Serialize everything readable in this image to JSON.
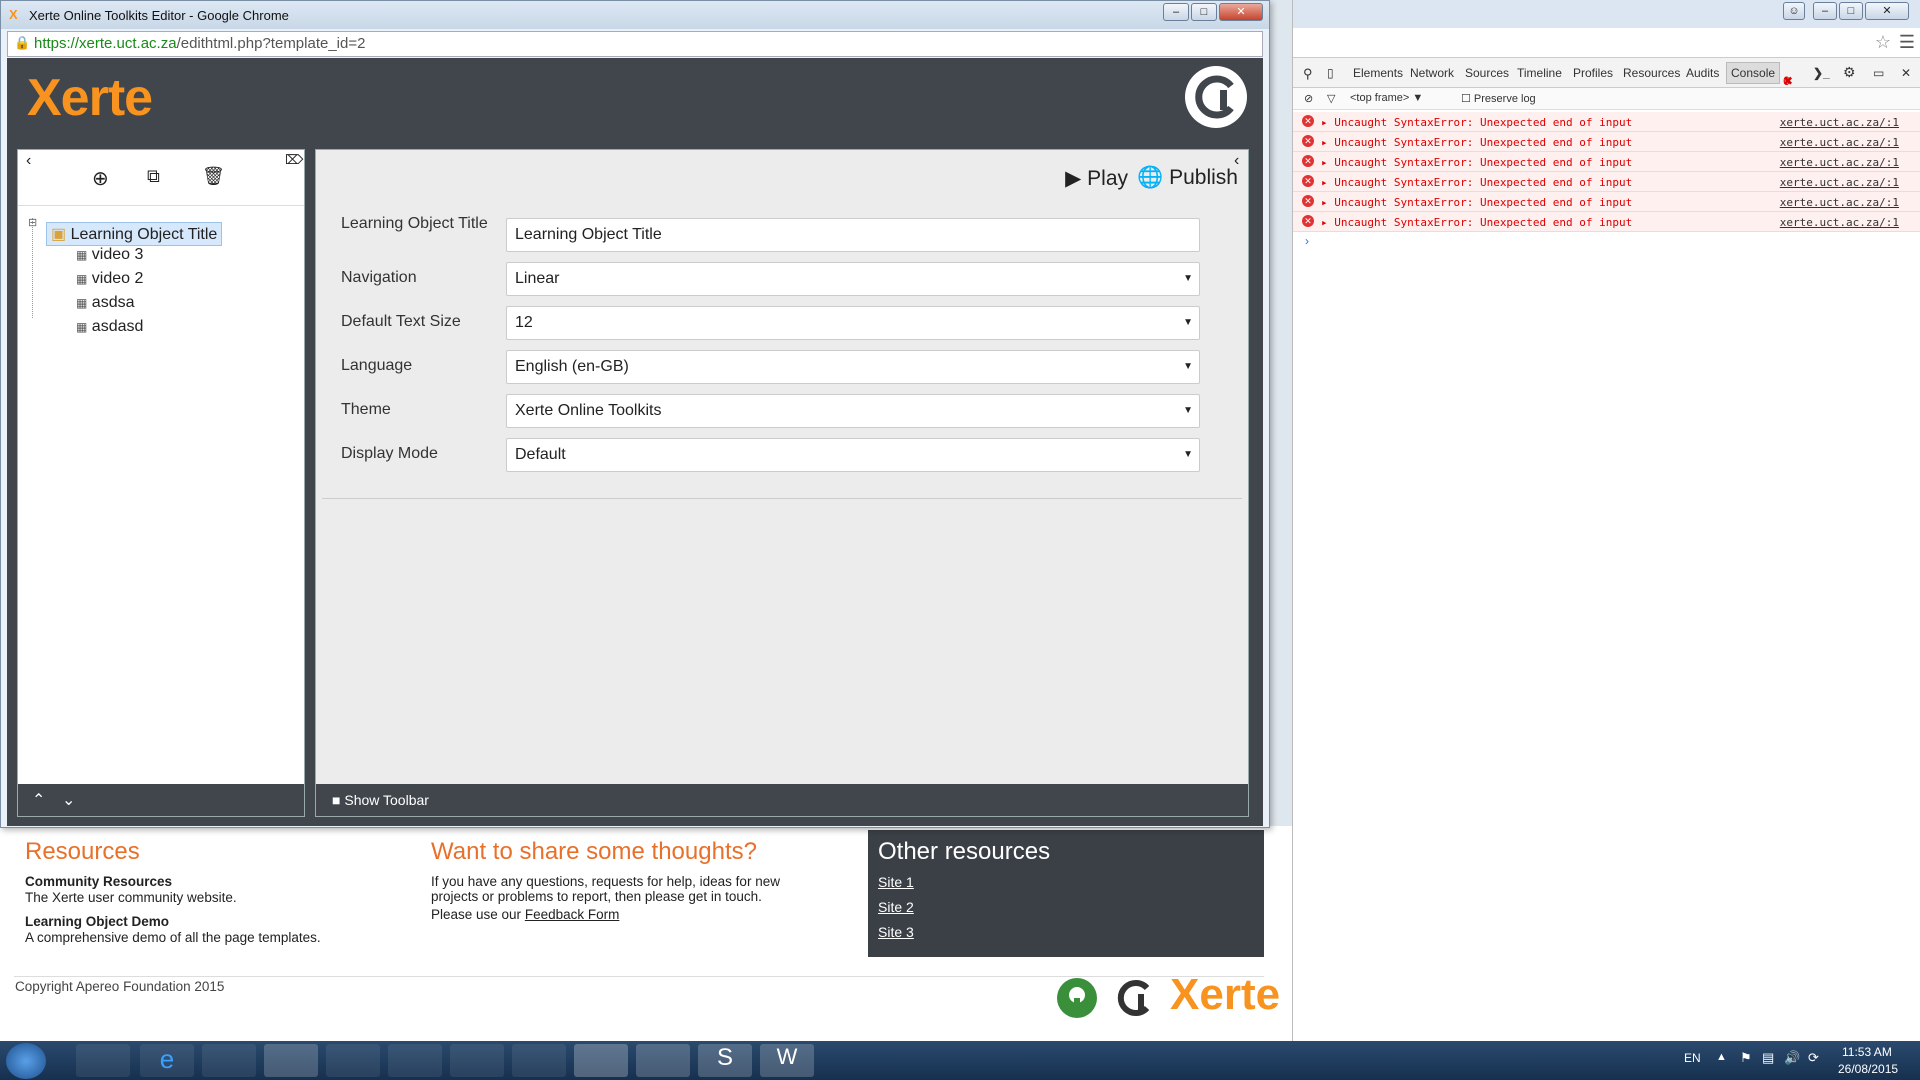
{
  "browser": {
    "window_title": "Xerte Online Toolkits Editor - Google Chrome",
    "url_host": "https://xerte.uct.ac.za",
    "url_path": "/edithtml.php?template_id=2"
  },
  "app": {
    "logo_text": "Xerte",
    "play_label": "Play",
    "publish_label": "Publish",
    "show_toolbar_label": "Show Toolbar"
  },
  "tree": {
    "root": "Learning Object Title",
    "children": [
      "video 3",
      "video 2",
      "asdsa",
      "asdasd"
    ]
  },
  "form": {
    "title_label": "Learning Object Title",
    "title_value": "Learning Object Title",
    "navigation_label": "Navigation",
    "navigation_value": "Linear",
    "textsize_label": "Default Text Size",
    "textsize_value": "12",
    "language_label": "Language",
    "language_value": "English (en-GB)",
    "theme_label": "Theme",
    "theme_value": "Xerte Online Toolkits",
    "display_label": "Display Mode",
    "display_value": "Default"
  },
  "page": {
    "resources_title": "Resources",
    "community_title": "Community Resources",
    "community_text": "The Xerte user community website.",
    "demo_title": "Learning Object Demo",
    "demo_text": "A comprehensive demo of all the page templates.",
    "share_title": "Want to share some thoughts?",
    "share_text1": "If you have any questions, requests for help, ideas for new",
    "share_text2": "projects or problems to report, then please get in touch.",
    "share_text3": "Please use our",
    "feedback_link": "Feedback Form",
    "other_title": "Other resources",
    "site1": "Site 1",
    "site2": "Site 2",
    "site3": "Site 3",
    "copyright": "Copyright Apereo Foundation 2015",
    "footer_logo": "Xerte"
  },
  "devtools": {
    "tabs": [
      "Elements",
      "Network",
      "Sources",
      "Timeline",
      "Profiles",
      "Resources",
      "Audits",
      "Console"
    ],
    "error_count": "6",
    "frame": "<top frame>",
    "preserve_log": "Preserve log",
    "errors": [
      {
        "msg": "Uncaught SyntaxError: Unexpected end of input",
        "src": "xerte.uct.ac.za/:1"
      },
      {
        "msg": "Uncaught SyntaxError: Unexpected end of input",
        "src": "xerte.uct.ac.za/:1"
      },
      {
        "msg": "Uncaught SyntaxError: Unexpected end of input",
        "src": "xerte.uct.ac.za/:1"
      },
      {
        "msg": "Uncaught SyntaxError: Unexpected end of input",
        "src": "xerte.uct.ac.za/:1"
      },
      {
        "msg": "Uncaught SyntaxError: Unexpected end of input",
        "src": "xerte.uct.ac.za/:1"
      },
      {
        "msg": "Uncaught SyntaxError: Unexpected end of input",
        "src": "xerte.uct.ac.za/:1"
      }
    ]
  },
  "taskbar": {
    "lang": "EN",
    "time": "11:53 AM",
    "date": "26/08/2015"
  }
}
